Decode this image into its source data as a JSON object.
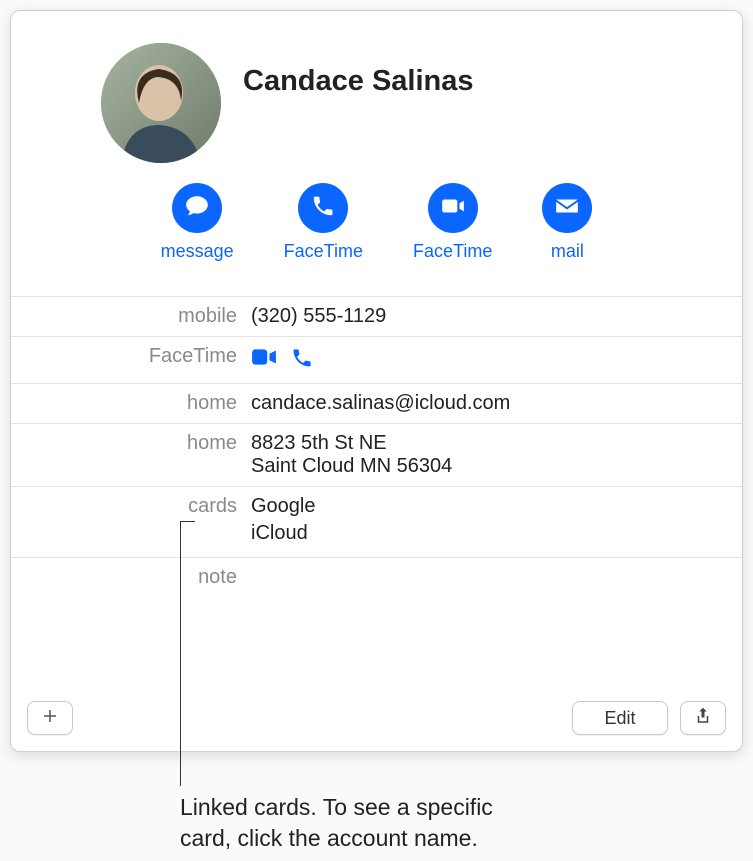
{
  "contact": {
    "name": "Candace Salinas"
  },
  "actions": {
    "message": "message",
    "facetime_audio": "FaceTime",
    "facetime_video": "FaceTime",
    "mail": "mail"
  },
  "fields": {
    "mobile": {
      "label": "mobile",
      "value": "(320) 555-1129"
    },
    "facetime": {
      "label": "FaceTime"
    },
    "email_home": {
      "label": "home",
      "value": "candace.salinas@icloud.com"
    },
    "address_home": {
      "label": "home",
      "line1": "8823 5th St NE",
      "line2": "Saint Cloud MN 56304"
    },
    "cards": {
      "label": "cards",
      "items": [
        "Google",
        "iCloud"
      ]
    },
    "note": {
      "label": "note",
      "value": ""
    }
  },
  "buttons": {
    "edit": "Edit"
  },
  "caption": {
    "line1": "Linked cards. To see a specific",
    "line2": "card, click the account name."
  }
}
